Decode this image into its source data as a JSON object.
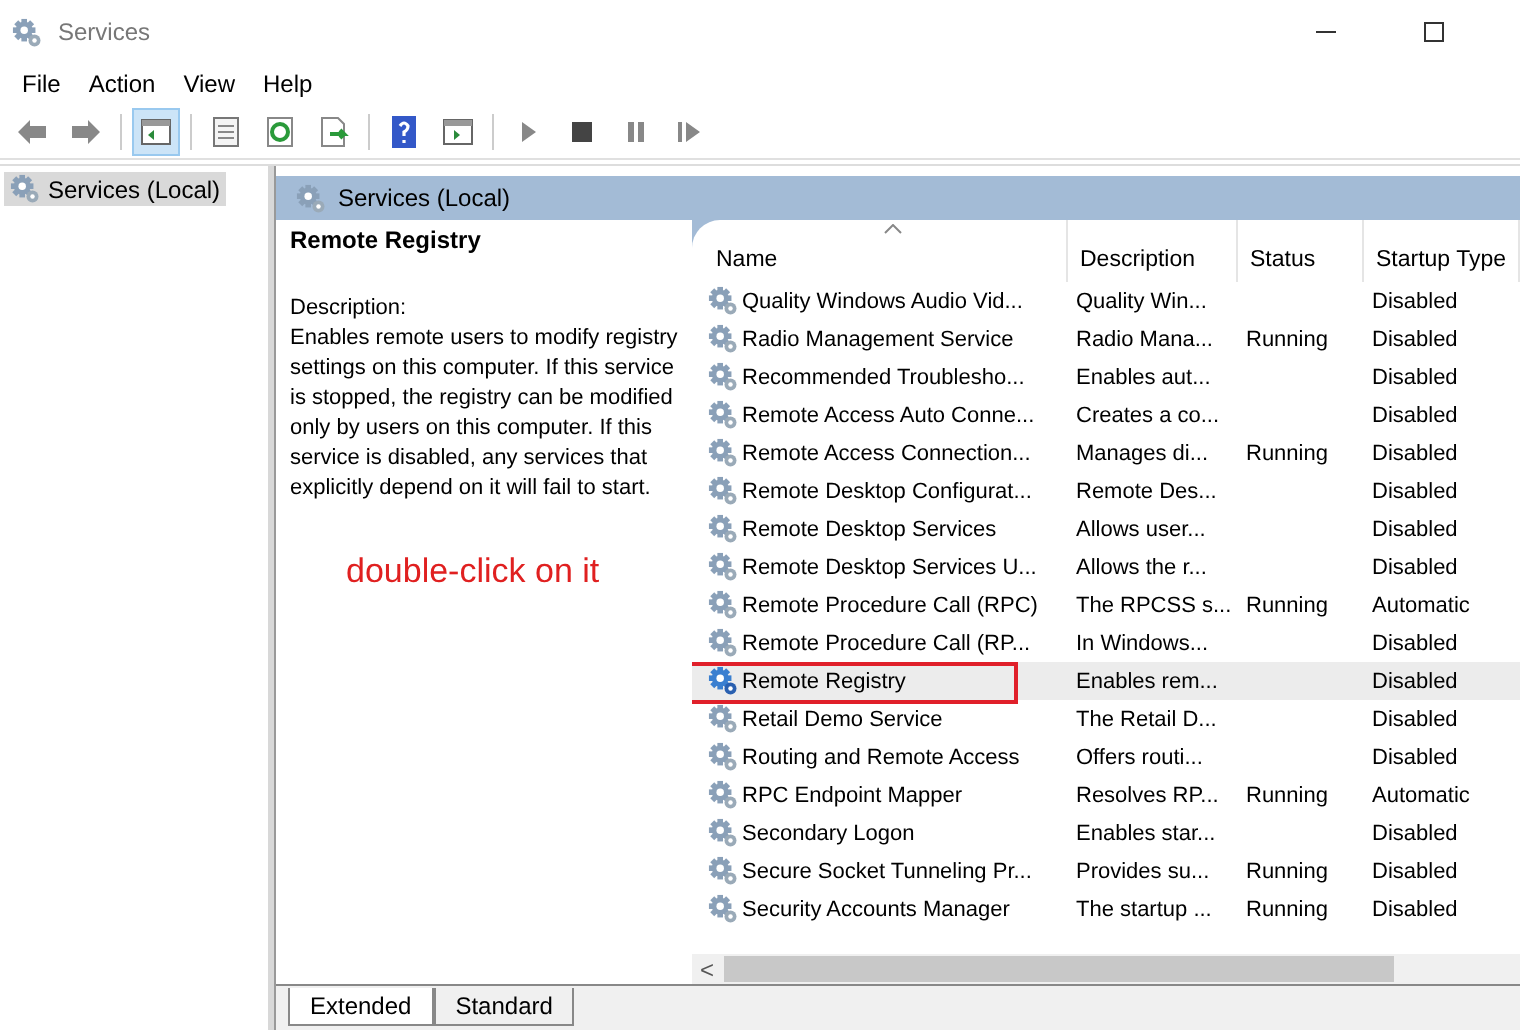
{
  "window": {
    "title": "Services"
  },
  "menu": [
    "File",
    "Action",
    "View",
    "Help"
  ],
  "toolbar": [
    {
      "kind": "back"
    },
    {
      "kind": "forward"
    },
    {
      "kind": "sep"
    },
    {
      "kind": "tree",
      "selected": true
    },
    {
      "kind": "sep"
    },
    {
      "kind": "properties",
      "selected": false
    },
    {
      "kind": "refresh",
      "selected": false
    },
    {
      "kind": "export",
      "selected": false
    },
    {
      "kind": "sep"
    },
    {
      "kind": "help",
      "selected": false
    },
    {
      "kind": "pane",
      "selected": false
    },
    {
      "kind": "sep"
    },
    {
      "kind": "play"
    },
    {
      "kind": "stop"
    },
    {
      "kind": "pause"
    },
    {
      "kind": "resume"
    }
  ],
  "tree": {
    "label": "Services (Local)",
    "selected": true
  },
  "header": "Services (Local)",
  "detail": {
    "title": "Remote Registry",
    "label": "Description:",
    "text": "Enables remote users to modify registry settings on this computer. If this service is stopped, the registry can be modified only by users on this computer. If this service is disabled, any services that explicitly depend on it will fail to start."
  },
  "annotation": "double-click on it",
  "columns": [
    "Name",
    "Description",
    "Status",
    "Startup Type"
  ],
  "rows": [
    {
      "name": "Quality Windows Audio Vid...",
      "description": "Quality Win...",
      "status": "",
      "startup": "Disabled",
      "selected": false
    },
    {
      "name": "Radio Management Service",
      "description": "Radio Mana...",
      "status": "Running",
      "startup": "Disabled",
      "selected": false
    },
    {
      "name": "Recommended Troublesho...",
      "description": "Enables aut...",
      "status": "",
      "startup": "Disabled",
      "selected": false
    },
    {
      "name": "Remote Access Auto Conne...",
      "description": "Creates a co...",
      "status": "",
      "startup": "Disabled",
      "selected": false
    },
    {
      "name": "Remote Access Connection...",
      "description": "Manages di...",
      "status": "Running",
      "startup": "Disabled",
      "selected": false
    },
    {
      "name": "Remote Desktop Configurat...",
      "description": "Remote Des...",
      "status": "",
      "startup": "Disabled",
      "selected": false
    },
    {
      "name": "Remote Desktop Services",
      "description": "Allows user...",
      "status": "",
      "startup": "Disabled",
      "selected": false
    },
    {
      "name": "Remote Desktop Services U...",
      "description": "Allows the r...",
      "status": "",
      "startup": "Disabled",
      "selected": false
    },
    {
      "name": "Remote Procedure Call (RPC)",
      "description": "The RPCSS s...",
      "status": "Running",
      "startup": "Automatic",
      "selected": false
    },
    {
      "name": "Remote Procedure Call (RP...",
      "description": "In Windows...",
      "status": "",
      "startup": "Disabled",
      "selected": false
    },
    {
      "name": "Remote Registry",
      "description": "Enables rem...",
      "status": "",
      "startup": "Disabled",
      "selected": true,
      "marked": true
    },
    {
      "name": "Retail Demo Service",
      "description": "The Retail D...",
      "status": "",
      "startup": "Disabled",
      "selected": false
    },
    {
      "name": "Routing and Remote Access",
      "description": "Offers routi...",
      "status": "",
      "startup": "Disabled",
      "selected": false
    },
    {
      "name": "RPC Endpoint Mapper",
      "description": "Resolves RP...",
      "status": "Running",
      "startup": "Automatic",
      "selected": false
    },
    {
      "name": "Secondary Logon",
      "description": "Enables star...",
      "status": "",
      "startup": "Disabled",
      "selected": false
    },
    {
      "name": "Secure Socket Tunneling Pr...",
      "description": "Provides su...",
      "status": "Running",
      "startup": "Disabled",
      "selected": false
    },
    {
      "name": "Security Accounts Manager",
      "description": "The startup ...",
      "status": "Running",
      "startup": "Disabled",
      "selected": false
    }
  ],
  "scroll_left": "<",
  "tabs": [
    {
      "label": "Extended",
      "selected": true
    },
    {
      "label": "Standard",
      "selected": false
    }
  ]
}
